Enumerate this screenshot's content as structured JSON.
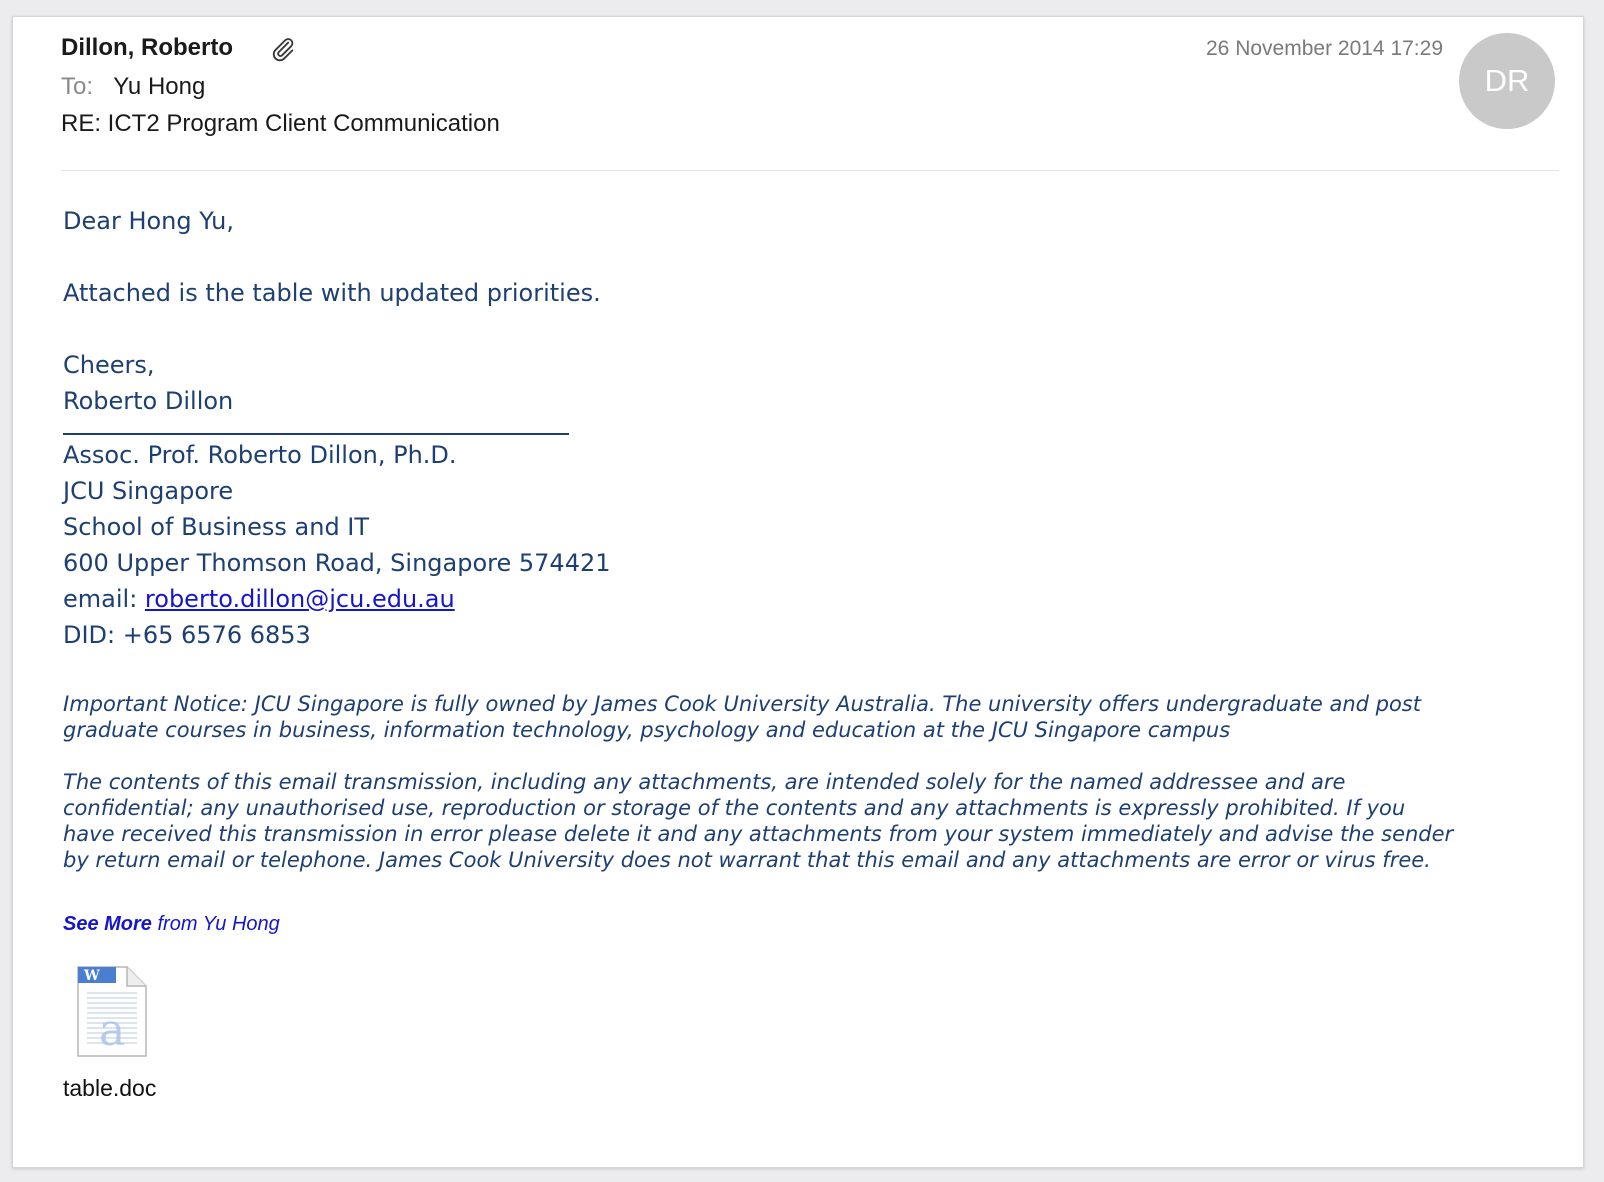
{
  "header": {
    "sender": "Dillon, Roberto",
    "to_label": "To:",
    "to_name": "Yu Hong",
    "subject": "RE: ICT2 Program Client Communication",
    "date": "26 November 2014 17:29",
    "avatar_initials": "DR",
    "attachment_indicator_icon": "paperclip-icon"
  },
  "body": {
    "greeting": "Dear Hong Yu,",
    "message": "Attached is the table with updated priorities.",
    "closing": "Cheers,",
    "signoff_name": "Roberto Dillon",
    "signature": {
      "title": "Assoc. Prof. Roberto Dillon, Ph.D.",
      "org": "JCU Singapore",
      "school": "School of Business and IT",
      "address": "600 Upper Thomson Road, Singapore 574421",
      "email_label": "email:",
      "email": "roberto.dillon@jcu.edu.au",
      "did": "DID: +65 6576 6853"
    },
    "notice_1_line_1": "Important Notice: JCU Singapore is fully owned by James Cook University Australia.  The university offers undergraduate and post",
    "notice_1_line_2": "graduate courses in business, information technology, psychology and education at the JCU Singapore campus",
    "notice_2_line_1": "The contents of this email transmission, including any attachments, are intended solely for the named addressee and are",
    "notice_2_line_2": "confidential; any unauthorised use, reproduction or storage of the contents and any attachments is expressly prohibited. If you",
    "notice_2_line_3": "have received this transmission in error please delete it and any attachments from your system immediately and advise the sender",
    "notice_2_line_4": "by return email or telephone. James Cook University does not warrant that this email and any attachments are error or virus free."
  },
  "see_more": {
    "bold": "See More",
    "rest": "from Yu Hong"
  },
  "attachment": {
    "icon": "word-document-icon",
    "filename": "table.doc"
  },
  "colors": {
    "body_text": "#1d3f73",
    "link": "#1515cc",
    "avatar_bg": "#c9c9c9"
  }
}
